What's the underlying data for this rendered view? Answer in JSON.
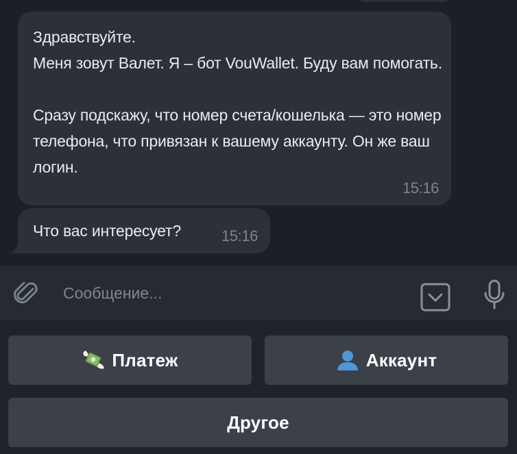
{
  "messages": [
    {
      "text": "Здравствуйте.\nМеня зовут Валет. Я – бот VouWallet. Буду вам помогать.\n\nСразу подскажу, что номер счета/кошелька — это номер телефона, что привязан к вашему аккаунту. Он же ваш логин.",
      "time": "15:16"
    },
    {
      "text": "Что вас интересует?",
      "time": "15:16"
    }
  ],
  "composer": {
    "placeholder": "Сообщение..."
  },
  "keyboard": {
    "buttons": [
      {
        "label": "Платеж",
        "icon": "money-wings-icon"
      },
      {
        "label": "Аккаунт",
        "icon": "user-silhouette-icon"
      },
      {
        "label": "Другое"
      }
    ]
  },
  "colors": {
    "background": "#1c1f25",
    "bubble": "#2c3038",
    "button": "#3b4049",
    "composer": "#252a33"
  }
}
